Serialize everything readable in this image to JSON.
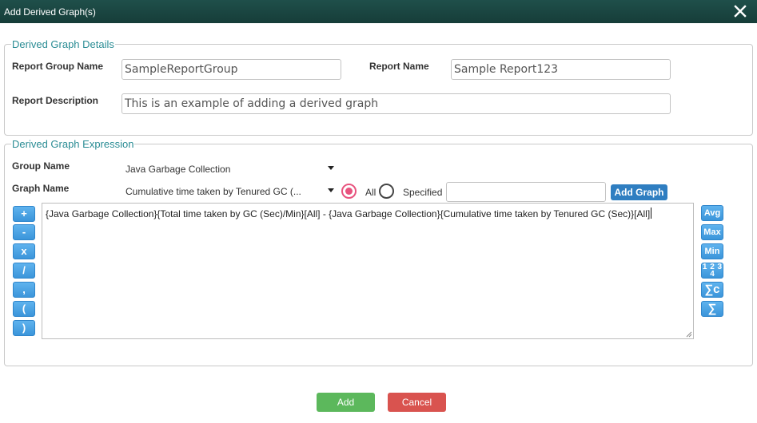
{
  "dialog": {
    "title": "Add Derived Graph(s)"
  },
  "details": {
    "legend": "Derived Graph Details",
    "report_group_label": "Report Group Name",
    "report_group_value": "SampleReportGroup",
    "report_name_label": "Report Name",
    "report_name_value": "Sample Report123",
    "report_description_label": "Report Description",
    "report_description_value": "This is an example of adding a derived graph"
  },
  "expression": {
    "legend": "Derived Graph Expression",
    "group_label": "Group Name",
    "group_value": "Java Garbage Collection",
    "graph_label": "Graph Name",
    "graph_value": "Cumulative time taken by Tenured GC (...",
    "radio_all": {
      "label": "All",
      "selected": true
    },
    "radio_specified": {
      "label": "Specified",
      "selected": false
    },
    "specified_value": "",
    "add_graph_label": "Add Graph",
    "operators": [
      "+",
      "-",
      "x",
      "/",
      ",",
      "(",
      ")"
    ],
    "functions": [
      "Avg",
      "Max",
      "Min",
      "1 2 3 4",
      "∑c",
      "∑"
    ],
    "text": "{Java Garbage Collection}{Total time taken by GC (Sec)/Min}[All] - {Java Garbage Collection}{Cumulative time taken by Tenured GC (Sec)}[All]"
  },
  "footer": {
    "add_label": "Add",
    "cancel_label": "Cancel"
  },
  "colors": {
    "title_bar": "#1a4541",
    "legend": "#2a8c94",
    "add": "#5cb85c",
    "cancel": "#d9534f",
    "accent_blue": "#2f7ec1",
    "radio_on": "#e8537e"
  }
}
